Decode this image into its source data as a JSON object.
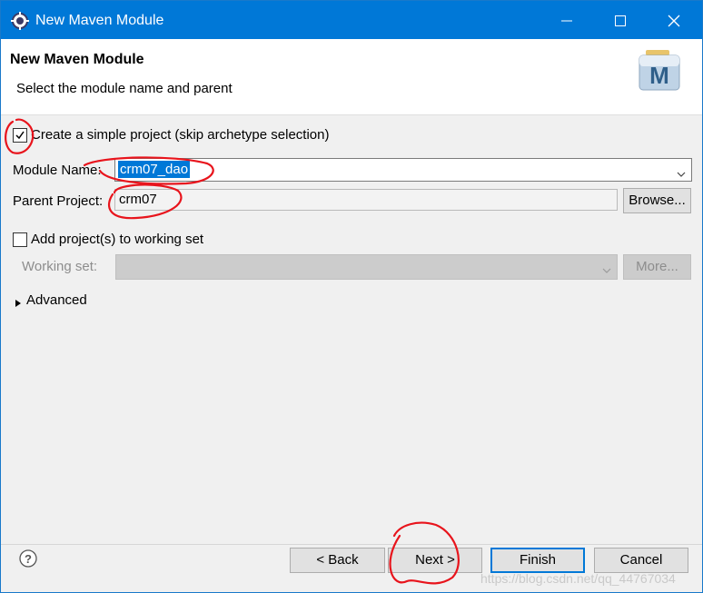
{
  "window": {
    "title": "New Maven Module"
  },
  "header": {
    "title": "New Maven Module",
    "subtitle": "Select the module name and parent",
    "logo_letter": "M"
  },
  "form": {
    "simple_project": {
      "label": "Create a simple project (skip archetype selection)",
      "checked": true
    },
    "module_name": {
      "label": "Module Name:",
      "value": "crm07_dao"
    },
    "parent_project": {
      "label": "Parent Project:",
      "value": "crm07"
    },
    "browse_label": "Browse...",
    "add_working_set": {
      "label": "Add project(s) to working set",
      "checked": false
    },
    "working_set": {
      "label": "Working set:",
      "value": ""
    },
    "more_label": "More...",
    "advanced_label": "Advanced"
  },
  "footer": {
    "back_label": "< Back",
    "next_label": "Next >",
    "finish_label": "Finish",
    "cancel_label": "Cancel"
  },
  "watermark": "https://blog.csdn.net/qq_44767034",
  "colors": {
    "titlebar": "#0078d7",
    "annotation": "#e8141c",
    "selection": "#0078d7"
  }
}
